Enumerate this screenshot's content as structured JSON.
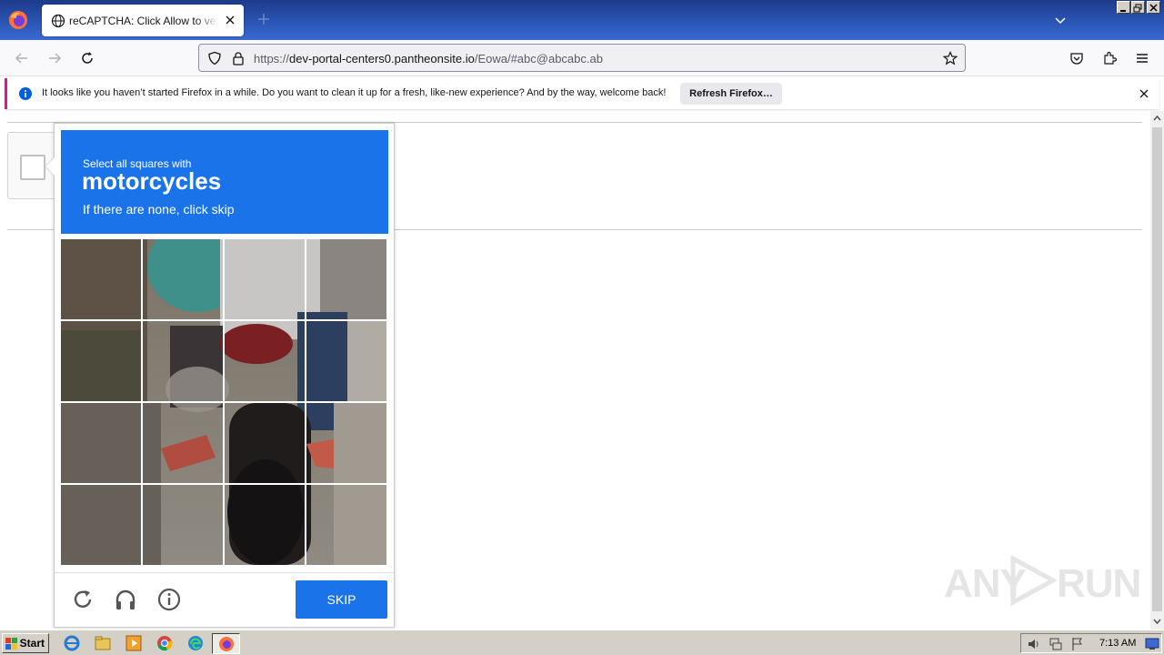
{
  "browser": {
    "tab_title": "reCAPTCHA: Click Allow to verify that you are not a robot",
    "url_prefix": "https://",
    "url_host": "dev-portal-centers0.pantheonsite.io",
    "url_path": "/Eowa/#abc@abcabc.ab"
  },
  "notification": {
    "message": "It looks like you haven’t started Firefox in a while. Do you want to clean it up for a fresh, like-new experience? And by the way, welcome back!",
    "button_label": "Refresh Firefox…"
  },
  "captcha": {
    "instruction": "Select all squares with",
    "target": "motorcycles",
    "hint": "If there are none, click skip",
    "skip_label": "SKIP",
    "grid_rows": 4,
    "grid_cols": 4
  },
  "watermark": {
    "left": "ANY",
    "right": "RUN"
  },
  "taskbar": {
    "start_label": "Start",
    "clock": "7:13 AM",
    "apps": [
      "ie-icon",
      "explorer-icon",
      "media-player-icon",
      "chrome-icon",
      "edge-icon",
      "firefox-icon"
    ]
  },
  "colors": {
    "accent": "#1a73e8",
    "notification_border": "#e31587",
    "titlebar": "#2c58b8"
  }
}
